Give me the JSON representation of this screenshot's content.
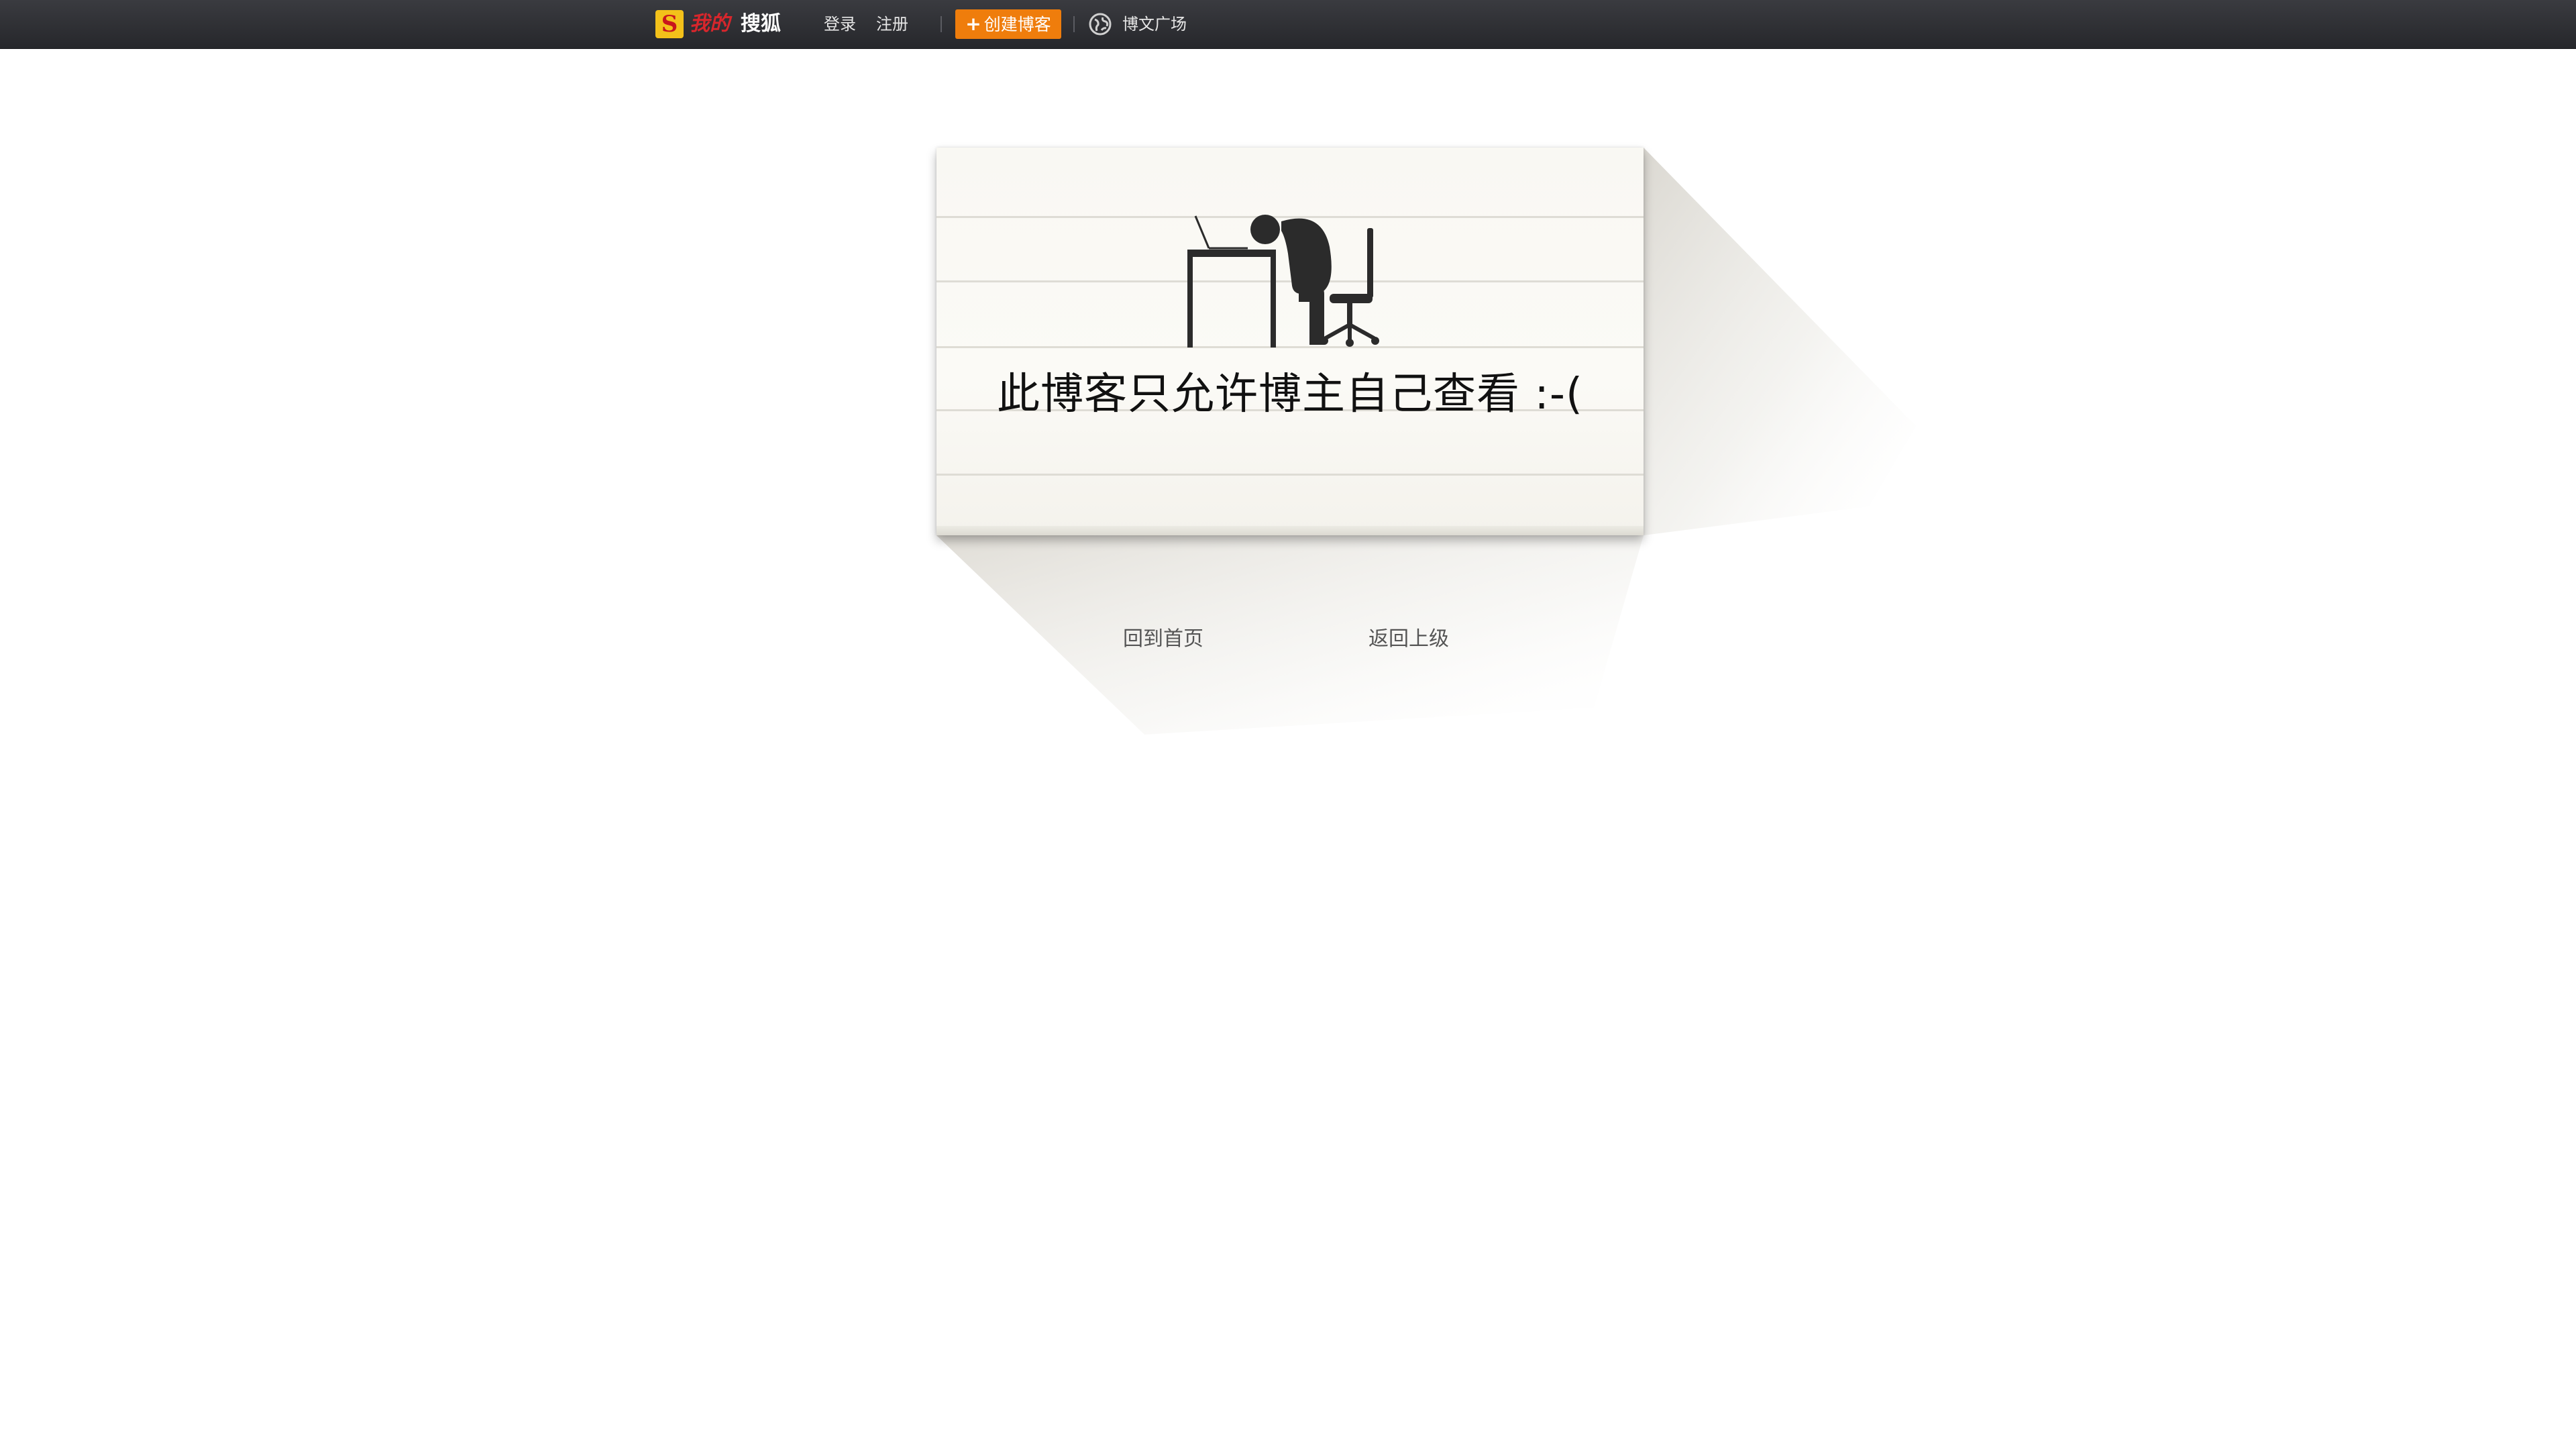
{
  "topbar": {
    "logo_badge": "S",
    "logo_my": "我的",
    "logo_brand": "搜狐",
    "login_label": "登录",
    "register_label": "注册",
    "create_blog_plus": "+",
    "create_blog_label": "创建博客",
    "square_label": "博文广场",
    "accent_color": "#ef7d0c",
    "logo_color": "#d7262c"
  },
  "main": {
    "message": "此博客只允许博主自己查看  :-(",
    "home_link": "回到首页",
    "back_link": "返回上级",
    "icon": "person-slumped-at-desk-icon"
  }
}
